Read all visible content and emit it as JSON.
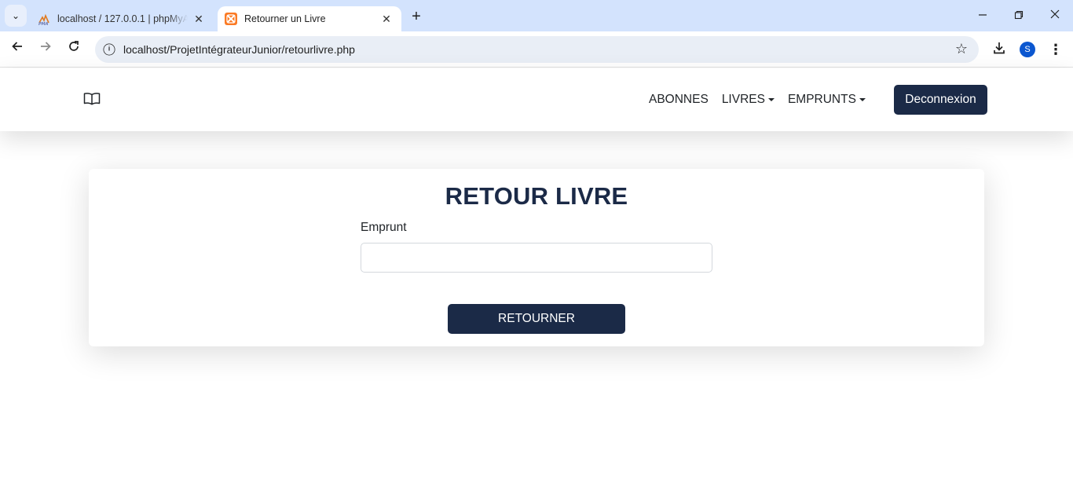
{
  "browser": {
    "tabs": [
      {
        "title": "localhost / 127.0.0.1 | phpMyAdmin",
        "favicon": "phpmyadmin-icon",
        "active": false
      },
      {
        "title": "Retourner un Livre",
        "favicon": "xampp-icon",
        "active": true
      }
    ],
    "url": "localhost/ProjetIntégrateurJunior/retourlivre.php",
    "profile_initial": "S"
  },
  "navbar": {
    "brand_icon": "book-icon",
    "links": [
      {
        "label": "ABONNES",
        "dropdown": false
      },
      {
        "label": "LIVRES",
        "dropdown": true
      },
      {
        "label": "EMPRUNTS",
        "dropdown": true
      }
    ],
    "logout_label": "Deconnexion"
  },
  "form": {
    "title": "RETOUR LIVRE",
    "field_label": "Emprunt",
    "field_value": "",
    "submit_label": "RETOURNER"
  },
  "colors": {
    "primary": "#1b2a47",
    "tabstrip": "#d3e3fd",
    "omnibox": "#e9eef6"
  }
}
